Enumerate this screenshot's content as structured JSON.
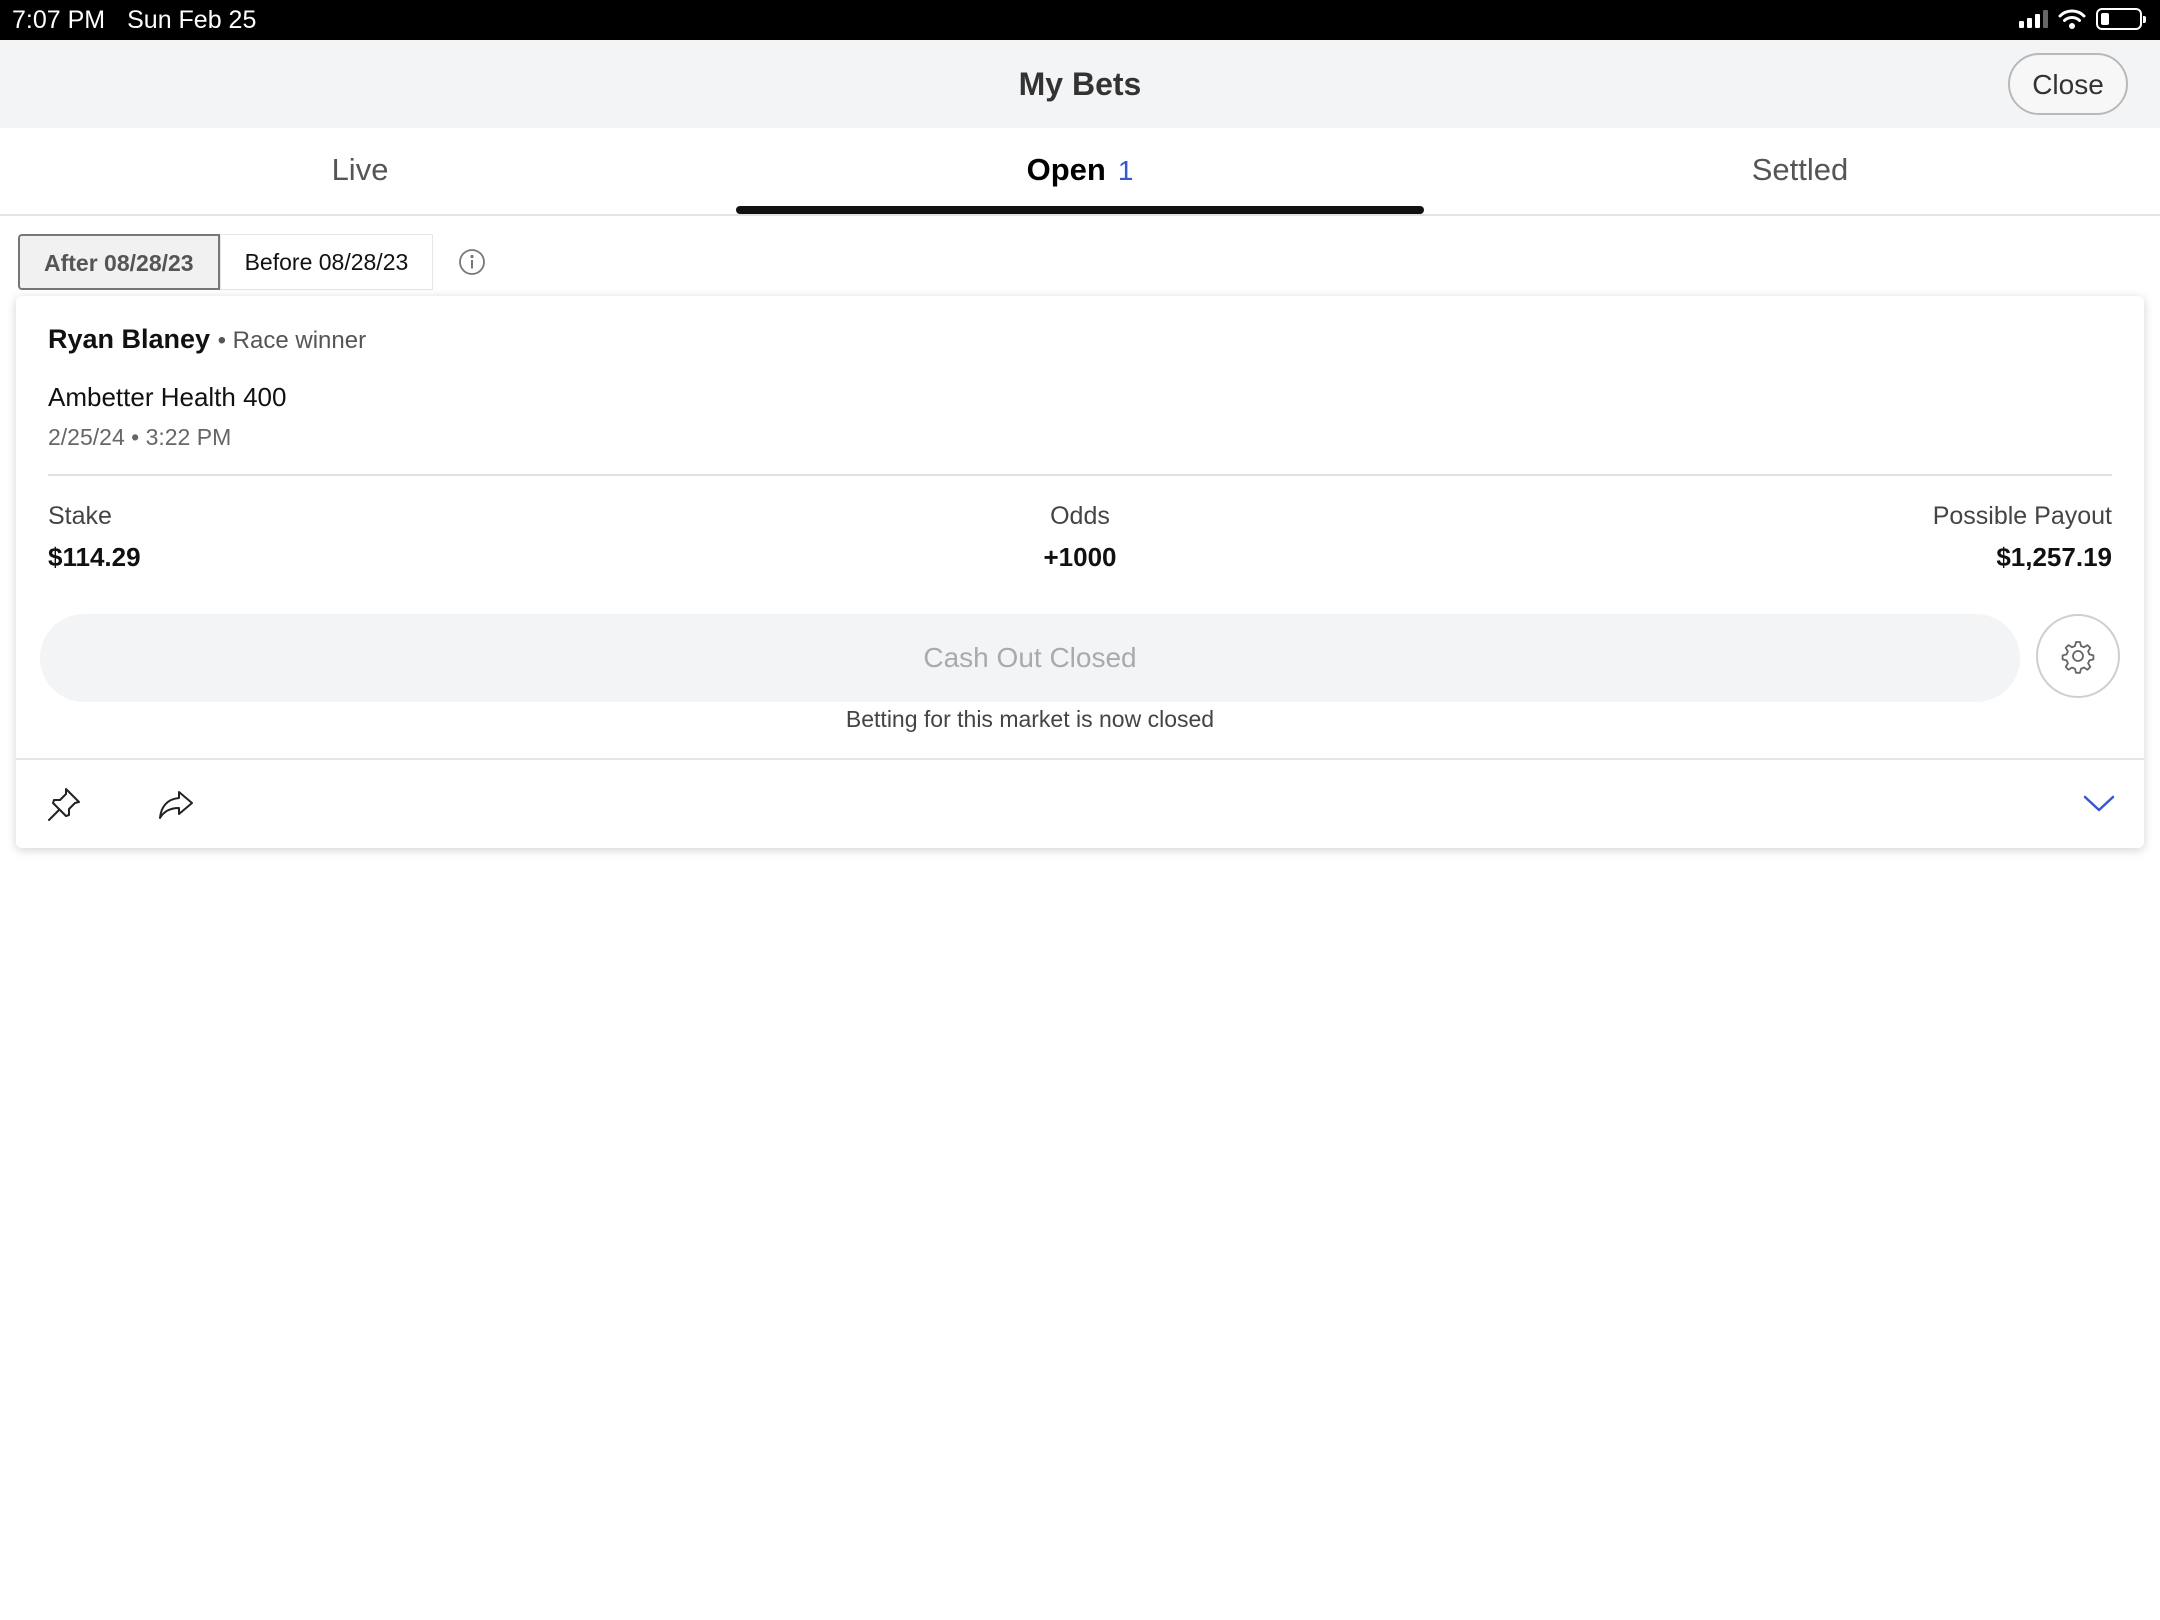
{
  "status_bar": {
    "time": "7:07 PM",
    "date": "Sun Feb 25"
  },
  "header": {
    "title": "My Bets",
    "close_label": "Close"
  },
  "tabs": [
    {
      "label": "Live"
    },
    {
      "label": "Open",
      "count": "1",
      "selected": true
    },
    {
      "label": "Settled"
    }
  ],
  "filters": {
    "after_label": "After 08/28/23",
    "before_label": "Before 08/28/23",
    "selected": "After 08/28/23"
  },
  "bet": {
    "selection": "Ryan Blaney",
    "market": "• Race winner",
    "event": "Ambetter Health 400",
    "datetime": "2/25/24 • 3:22 PM",
    "stake_label": "Stake",
    "stake": "$114.29",
    "odds_label": "Odds",
    "odds": "+1000",
    "payout_label": "Possible Payout",
    "payout": "$1,257.19",
    "cashout_label": "Cash Out Closed",
    "closed_note": "Betting for this market is now closed"
  },
  "icons": {
    "info": "info-icon",
    "settings": "gear-icon",
    "pin": "pin-icon",
    "share": "share-icon",
    "expand": "chevron-down-icon"
  },
  "colors": {
    "accent": "#3557d6",
    "tab_underline": "#111111",
    "header_bg": "#f3f4f5",
    "cashout_bg": "#f3f4f5"
  }
}
